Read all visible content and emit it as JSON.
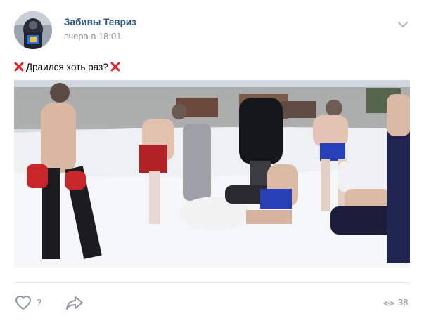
{
  "post": {
    "author": "Забивы Тевриз",
    "time": "вчера в 18:01",
    "text": "Драился хоть раз?",
    "emoji_icon": "cross-mark-icon",
    "photo_description_icon": "fight-photo"
  },
  "actions": {
    "likes": "7",
    "views": "38",
    "like_icon": "heart-icon",
    "share_icon": "share-arrow-icon",
    "views_icon": "eye-icon"
  },
  "colors": {
    "author_link": "#2a5885",
    "meta_gray": "#939393",
    "emoji_red": "#e0262b"
  }
}
